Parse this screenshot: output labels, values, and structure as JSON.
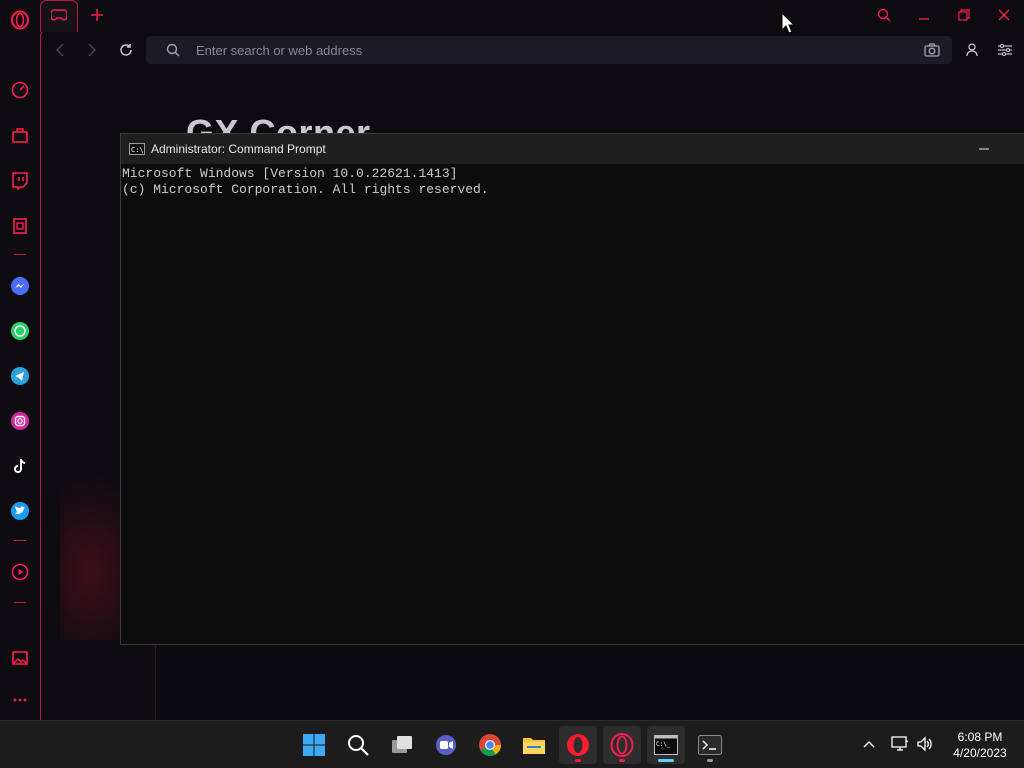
{
  "colors": {
    "accent": "#fa1e4e",
    "sidebar_bg": "#0e0c11",
    "cmd_bg": "#0c0c0c",
    "taskbar_bg": "#1c1c1c"
  },
  "browser": {
    "name": "Opera GX",
    "tabs": [
      {
        "icon": "gamepad-icon"
      }
    ],
    "address_placeholder": "Enter search or web address",
    "page_heading": "GX Corner",
    "sidebar_items": [
      {
        "name": "gx-control-icon"
      },
      {
        "name": "gx-store-icon"
      },
      {
        "name": "twitch-icon"
      },
      {
        "name": "gx-cleaner-icon"
      },
      {
        "name": "messenger-icon"
      },
      {
        "name": "whatsapp-icon"
      },
      {
        "name": "telegram-icon"
      },
      {
        "name": "instagram-icon"
      },
      {
        "name": "tiktok-icon"
      },
      {
        "name": "twitter-icon"
      },
      {
        "name": "player-icon"
      },
      {
        "name": "snapshot-gallery-icon"
      },
      {
        "name": "more-icon"
      }
    ]
  },
  "cmd": {
    "title": "Administrator: Command Prompt",
    "output": "Microsoft Windows [Version 10.0.22621.1413]\n(c) Microsoft Corporation. All rights reserved."
  },
  "taskbar": {
    "apps": [
      {
        "name": "start-icon"
      },
      {
        "name": "search-icon"
      },
      {
        "name": "task-view-icon"
      },
      {
        "name": "teams-chat-icon"
      },
      {
        "name": "chrome-icon"
      },
      {
        "name": "file-explorer-icon"
      },
      {
        "name": "opera-icon"
      },
      {
        "name": "opera-gx-icon"
      },
      {
        "name": "command-prompt-icon"
      },
      {
        "name": "terminal-icon"
      }
    ],
    "clock": {
      "time": "6:08 PM",
      "date": "4/20/2023"
    }
  }
}
